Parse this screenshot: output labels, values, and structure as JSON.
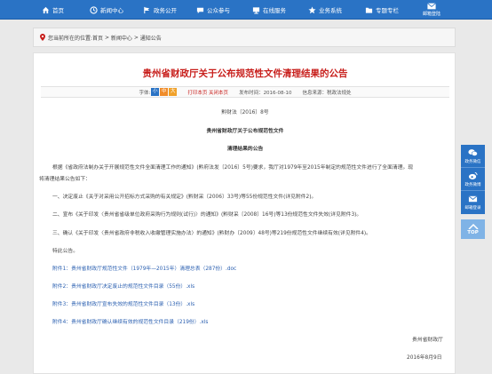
{
  "nav": {
    "items": [
      {
        "label": "首页",
        "icon": "home-icon"
      },
      {
        "label": "新闻中心",
        "icon": "news-icon"
      },
      {
        "label": "政务公开",
        "icon": "flag-icon"
      },
      {
        "label": "公众参与",
        "icon": "chat-icon"
      },
      {
        "label": "在线服务",
        "icon": "monitor-icon"
      },
      {
        "label": "业务系统",
        "icon": "star-icon"
      },
      {
        "label": "专题专栏",
        "icon": "folder-icon"
      }
    ],
    "login_label": "邮箱登陆"
  },
  "breadcrumb": {
    "prefix": "您当前所在的位置:",
    "items": [
      "首页",
      "新闻中心",
      "通知公告"
    ],
    "sep": " > "
  },
  "article": {
    "title": "贵州省财政厅关于公布规范性文件清理结果的公告",
    "meta": {
      "font_label": "字体:",
      "font_small": "小",
      "font_medium": "中",
      "font_large": "大",
      "print_close": "打印本页 关闭本页",
      "date": "发布时间：2016-08-10",
      "source": "信息来源：税政法规处"
    },
    "doc_number": "黔财法〔2016〕8号",
    "subtitle": "贵州省财政厅关于公布规范性文件",
    "subtitle2": "清理结果的公告",
    "paragraphs": [
      "根据《省政府法制办关于开展规范性文件全面清理工作的通知》(黔府法发〔2016〕5号)要求，我厅对1979年至2015年制定的规范性文件进行了全面清理。现",
      "将清理结果公告如下：",
      "一、决定废止《关于对采用公开招标方式采购的有关规定》(黔财采〔2006〕33号)等55份规范性文件(详见附件2)。",
      "二、宣布《关于印发〈贵州省省级单位政府采购行为规则(试行)〉的通知》(黔财采〔2008〕16号)等13份规范性文件失效(详见附件3)。",
      "三、确认《关于印发〈贵州省政府非税收入收缴管理实施办法〉的通知》(黔财办〔2009〕48号)等219份规范性文件继续有效(详见附件4)。",
      "特此公告。"
    ],
    "attachments": [
      "附件1：贵州省财政厅规范性文件（1979年—2015年）清理总表（287份）.doc",
      "附件2：贵州省财政厅决定废止的规范性文件目录（55份）.xls",
      "附件3：贵州省财政厅宣布失效的规范性文件目录（13份）.xls",
      "附件4：贵州省财政厅确认继续有效的规范性文件目录（219份）.xls"
    ],
    "signature": "贵州省财政厅",
    "sign_date": "2016年8月9日"
  },
  "float": {
    "items": [
      {
        "label": "政务微信",
        "icon": "wechat-icon"
      },
      {
        "label": "政务微博",
        "icon": "weibo-icon"
      },
      {
        "label": "邮箱登录",
        "icon": "mail-icon"
      }
    ],
    "top_label": "TOP"
  },
  "colors": {
    "nav": "#2a73c5",
    "title": "#c8201d",
    "link": "#2a5fb0"
  }
}
